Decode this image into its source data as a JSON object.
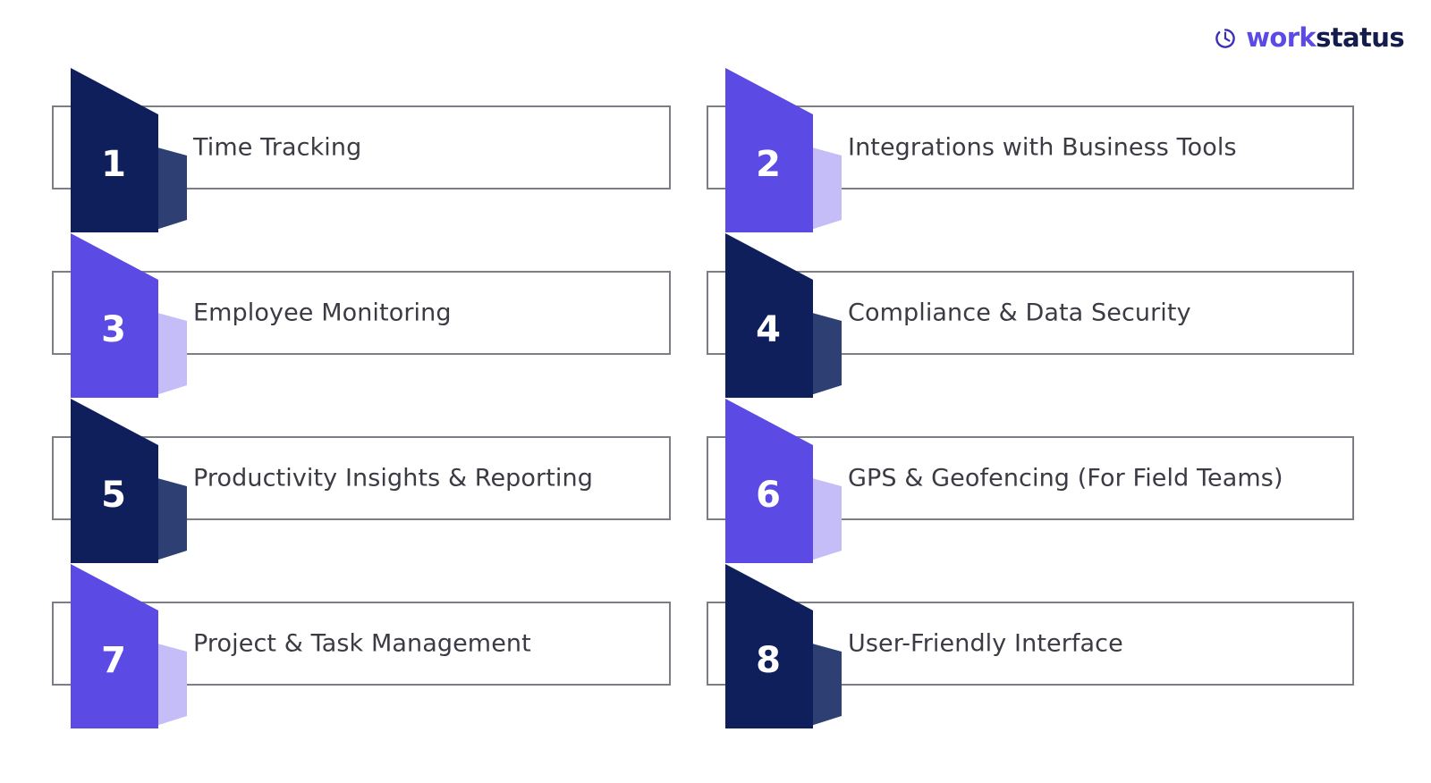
{
  "brand": {
    "logo_icon": "timer-clock-icon",
    "name_part1": "work",
    "name_part2": "status",
    "color_purple": "#5b4ae3",
    "color_navy": "#141b4d"
  },
  "theme": {
    "background": "#ffffff",
    "card_border": "#7d7d85",
    "card_fill": "#ffffff",
    "label_text": "#3b3b44",
    "badge_navy": "#0f1f5c",
    "badge_navy_shadow": "#2e3f73",
    "badge_purple": "#5b4ae3",
    "badge_purple_shadow": "#c4bdf7",
    "number_text": "#ffffff"
  },
  "items": [
    {
      "number": "1",
      "label": "Time Tracking",
      "color": "navy",
      "column": "left",
      "row": 1
    },
    {
      "number": "2",
      "label": "Integrations with Business Tools",
      "color": "purple",
      "column": "right",
      "row": 1
    },
    {
      "number": "3",
      "label": "Employee Monitoring",
      "color": "purple",
      "column": "left",
      "row": 2
    },
    {
      "number": "4",
      "label": "Compliance & Data Security",
      "color": "navy",
      "column": "right",
      "row": 2
    },
    {
      "number": "5",
      "label": "Productivity Insights & Reporting",
      "color": "navy",
      "column": "left",
      "row": 3
    },
    {
      "number": "6",
      "label": "GPS & Geofencing (For Field Teams)",
      "color": "purple",
      "column": "right",
      "row": 3
    },
    {
      "number": "7",
      "label": "Project & Task Management",
      "color": "purple",
      "column": "left",
      "row": 4
    },
    {
      "number": "8",
      "label": "User-Friendly Interface",
      "color": "navy",
      "column": "right",
      "row": 4
    }
  ]
}
